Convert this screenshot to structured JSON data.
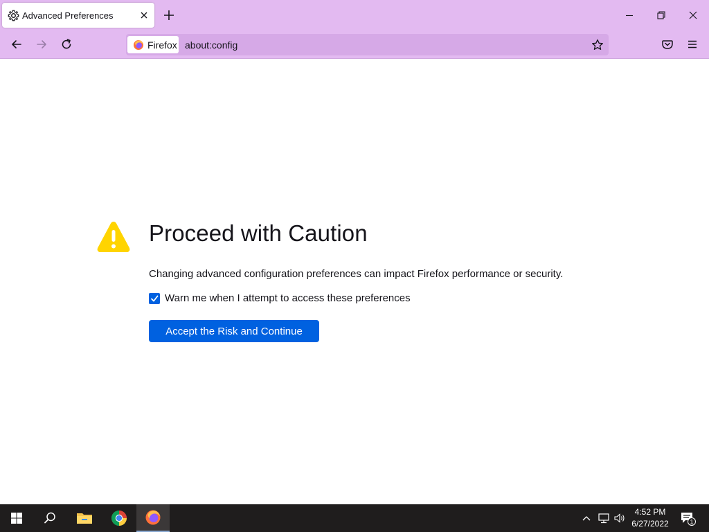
{
  "browser": {
    "tab": {
      "title": "Advanced Preferences"
    },
    "identity_label": "Firefox",
    "url": "about:config"
  },
  "content": {
    "heading": "Proceed with Caution",
    "description": "Changing advanced configuration preferences can impact Firefox performance or security.",
    "checkbox_label": "Warn me when I attempt to access these preferences",
    "checkbox_checked": true,
    "accept_button": "Accept the Risk and Continue"
  },
  "taskbar": {
    "time": "4:52 PM",
    "date": "6/27/2022",
    "notification_count": "1"
  },
  "colors": {
    "chrome": "#e3baf1",
    "urlbar": "#d6a9e7",
    "accent": "#0061e0",
    "warning": "#ffd400"
  }
}
